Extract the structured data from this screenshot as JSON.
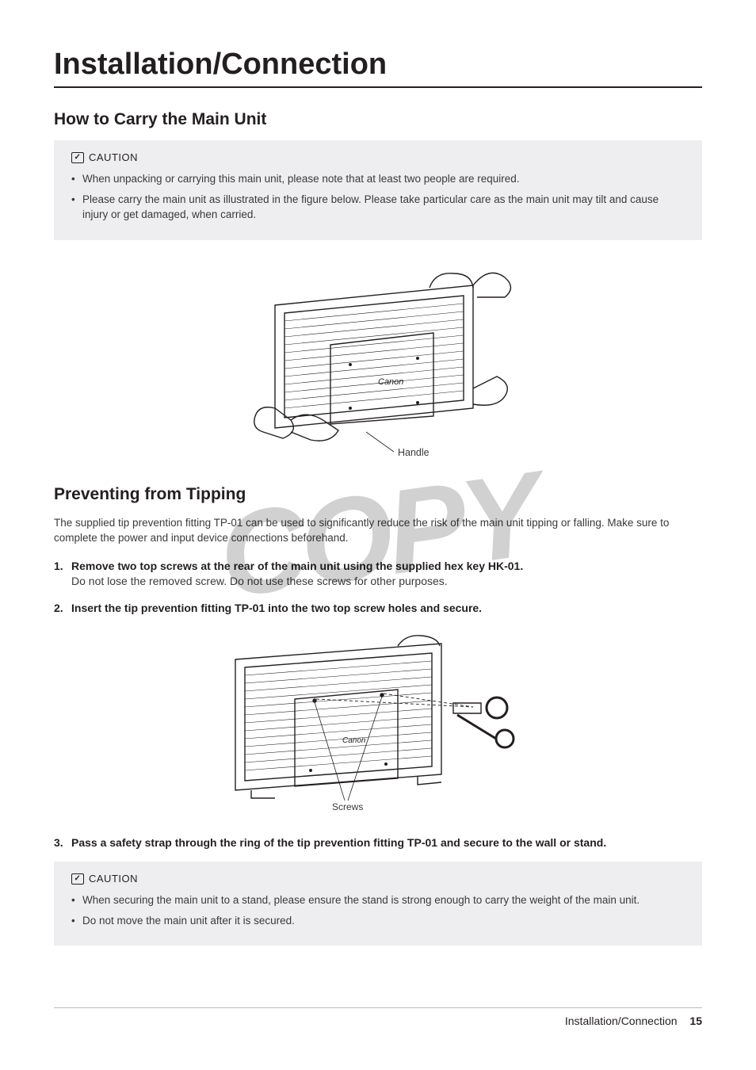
{
  "page_title": "Installation/Connection",
  "watermark": "COPY",
  "section1": {
    "heading": "How to Carry the Main Unit",
    "caution_label": "CAUTION",
    "caution_items": [
      "When unpacking or carrying this main unit, please note that at least two people are required.",
      "Please carry the main unit as illustrated in the figure below. Please take particular care as the main unit may tilt and cause injury or get damaged, when carried."
    ],
    "figure_label": "Handle",
    "figure_brand": "Canon"
  },
  "section2": {
    "heading": "Preventing from Tipping",
    "intro": "The supplied tip prevention fitting TP-01 can be used to significantly reduce the risk of the main unit tipping or falling. Make sure to complete the power and input device connections beforehand.",
    "steps": [
      {
        "title": "Remove two top screws at the rear of the main unit using the supplied hex key HK-01.",
        "sub": "Do not lose the removed screw. Do not use these screws for other purposes."
      },
      {
        "title": "Insert the tip prevention fitting TP-01 into the two top screw holes and secure.",
        "sub": ""
      },
      {
        "title": "Pass a safety strap through the ring of the tip prevention fitting TP-01 and secure to the wall or stand.",
        "sub": ""
      }
    ],
    "figure_label": "Screws",
    "figure_brand": "Canon",
    "caution_label": "CAUTION",
    "caution_items": [
      "When securing the main unit to a stand, please ensure the stand is strong enough to carry the weight of the main unit.",
      "Do not move the main unit after it is secured."
    ]
  },
  "footer": {
    "section": "Installation/Connection",
    "page_number": "15"
  }
}
